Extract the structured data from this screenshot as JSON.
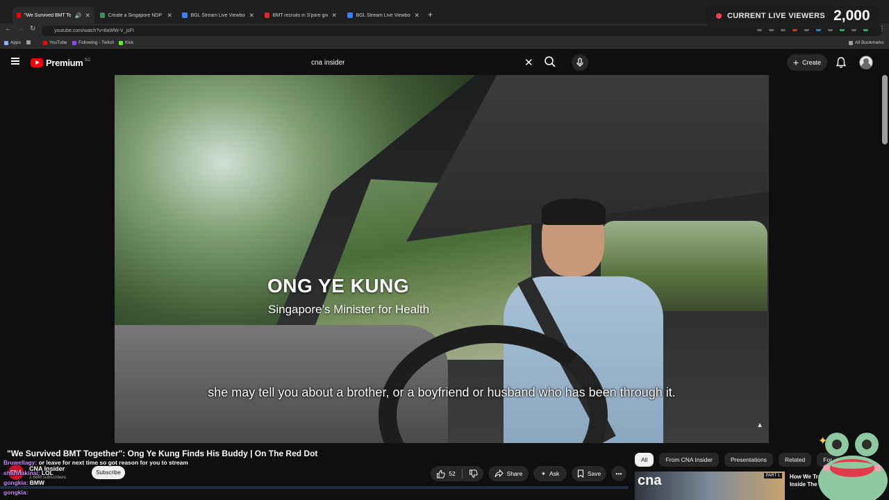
{
  "browser": {
    "tabs": [
      {
        "title": "\"We Survived BMT Together\"",
        "favicon_color": "#ff0000",
        "active": true
      },
      {
        "title": "Create a Singapore NDP Song",
        "favicon_color": "#3c8d5a",
        "active": false
      },
      {
        "title": "BGL Stream Live Viewbots",
        "favicon_color": "#3b82f6",
        "active": false
      },
      {
        "title": "BMT recruits in S'pore given m",
        "favicon_color": "#e0242c",
        "active": false
      },
      {
        "title": "BGL Stream Live Viewbots",
        "favicon_color": "#3b82f6",
        "active": false
      }
    ],
    "new_tab_symbol": "+",
    "url": "youtube.com/watch?v=8aWW-V_jsFI",
    "bookmarks": [
      {
        "label": "Apps",
        "color": "#8ab4f8"
      },
      {
        "label": "YouTube",
        "color": "#ff0000"
      },
      {
        "label": "Following - Twitch",
        "color": "#9146ff"
      },
      {
        "label": "Kick",
        "color": "#53fc18"
      }
    ],
    "all_bookmarks_label": "All Bookmarks"
  },
  "overlay": {
    "viewers_label": "CURRENT LIVE VIEWERS",
    "viewers_count": "2,000"
  },
  "youtube": {
    "logo_text": "Premium",
    "country_code": "SG",
    "search_value": "cna insider",
    "create_label": "Create"
  },
  "video": {
    "name_title": "ONG YE KUNG",
    "name_subtitle": "Singapore’s Minister for Health",
    "caption": "she may tell you about a brother, or a boyfriend or husband who has been through it.",
    "title": "\"We Survived BMT Together\": Ong Ye Kung Finds His Buddy | On The Red Dot"
  },
  "channel": {
    "name": "CNA Insider",
    "subscribers": "2.66M subscribers",
    "subscribe_label": "Subscribe",
    "avatar_text": "CNA"
  },
  "actions": {
    "like_count": "52",
    "share_label": "Share",
    "ask_label": "Ask",
    "save_label": "Save"
  },
  "chat": [
    {
      "user": "Bruwellagy:",
      "text": "or leave for next time so got reason for you to stream"
    },
    {
      "user": "sharinakinai:",
      "text": "LOL"
    },
    {
      "user": "gongkia:",
      "text": "BMW"
    },
    {
      "user": "gongkia:",
      "text": ""
    }
  ],
  "chips": [
    "All",
    "From CNA Insider",
    "Presentations",
    "Related",
    "For"
  ],
  "related": {
    "thumb_logo": "cna",
    "thumb_tag": "PART 1",
    "title": "How We Train Inside The"
  }
}
